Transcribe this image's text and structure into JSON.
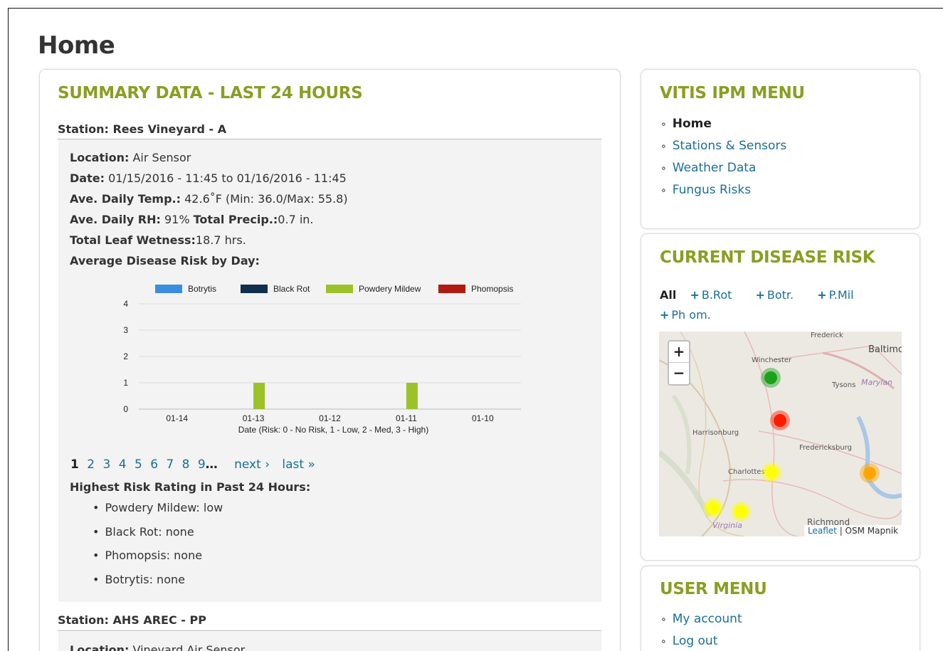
{
  "page": {
    "title": "Home"
  },
  "summary": {
    "title": "SUMMARY DATA - LAST 24 HOURS",
    "station1": {
      "header": "Station: Rees Vineyard - A",
      "location_label": "Location:",
      "location": " Air Sensor",
      "date_label": "Date:",
      "date": " 01/15/2016 - 11:45 to 01/16/2016 - 11:45",
      "temp_label": "Ave. Daily Temp.:",
      "temp": " 42.6˚F (Min: 36.0/Max: 55.8)",
      "rh_label": "Ave. Daily RH:",
      "rh": " 91% ",
      "precip_label": "Total Precip.:",
      "precip": "0.7 in.",
      "leaf_label": "Total Leaf Wetness:",
      "leaf": "18.7 hrs.",
      "avg_risk_label": "Average Disease Risk by Day:",
      "highest_label": "Highest Risk Rating in Past 24 Hours:",
      "highest": [
        "Powdery Mildew: low",
        "Black Rot: none",
        "Phomopsis: none",
        "Botrytis: none"
      ]
    },
    "pager": {
      "pages": [
        "1",
        "2",
        "3",
        "4",
        "5",
        "6",
        "7",
        "8",
        "9"
      ],
      "ellipsis": "…",
      "next": "next ›",
      "last": "last »"
    },
    "station2": {
      "header": "Station: AHS AREC - PP",
      "location_label": "Location:",
      "location": " Vineyard Air Sensor"
    }
  },
  "chart_data": {
    "type": "bar",
    "categories": [
      "01-14",
      "01-13",
      "01-12",
      "01-11",
      "01-10"
    ],
    "series": [
      {
        "name": "Botrytis",
        "color": "#3a8ee0",
        "values": [
          0,
          0,
          0,
          0,
          0
        ]
      },
      {
        "name": "Black Rot",
        "color": "#10304e",
        "values": [
          0,
          0,
          0,
          0,
          0
        ]
      },
      {
        "name": "Powdery Mildew",
        "color": "#9bc229",
        "values": [
          0,
          1,
          0,
          1,
          0
        ]
      },
      {
        "name": "Phomopsis",
        "color": "#b01a10",
        "values": [
          0,
          0,
          0,
          0,
          0
        ]
      }
    ],
    "xlabel": "Date (Risk: 0 - No Risk, 1 - Low, 2 - Med, 3 - High)",
    "ylabel": "",
    "ylim": [
      0,
      4
    ],
    "yticks": [
      "0",
      "1",
      "2",
      "3",
      "4"
    ],
    "legend": "top",
    "grid": true
  },
  "sidebar": {
    "ipm_menu": {
      "title": "VITIS IPM MENU",
      "items": [
        "Home",
        "Stations & Sensors",
        "Weather Data",
        "Fungus Risks"
      ]
    },
    "disease": {
      "title": "CURRENT DISEASE RISK",
      "filter_all": "All",
      "filters": [
        "B.Rot",
        "Botr.",
        "P.Mil",
        "Ph om."
      ],
      "plus": "+",
      "map": {
        "zoom_in": "+",
        "zoom_out": "−",
        "attribution_link": "Leaflet",
        "attribution_sep": " | ",
        "attribution_text": "OSM Mapnik",
        "labels": [
          "Frederick",
          "Baltimo",
          "Winchester",
          "Tysons",
          "Marylan",
          "Harrisonburg",
          "Fredericksburg",
          "Charlottesv",
          "Virginia",
          "Richmond"
        ],
        "marker_colors": {
          "green": "#1aa21a",
          "red": "#ff1a00",
          "yellow": "#ffff00",
          "orange": "#ffa500"
        }
      }
    },
    "user_menu": {
      "title": "USER MENU",
      "items": [
        "My account",
        "Log out"
      ]
    }
  }
}
